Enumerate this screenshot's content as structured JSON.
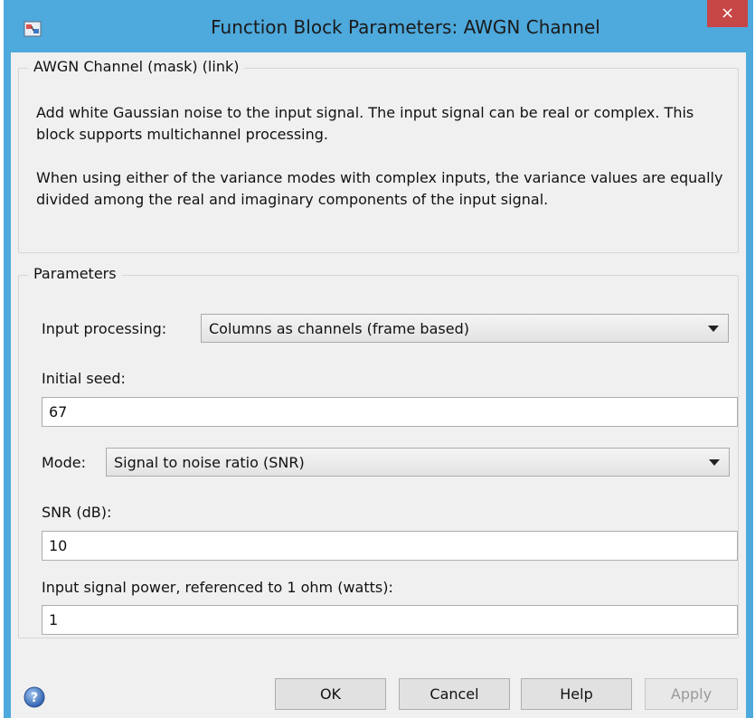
{
  "window": {
    "title": "Function Block Parameters: AWGN Channel",
    "close_glyph": "×",
    "icon": "simulink-block-icon"
  },
  "description": {
    "group_label": "AWGN Channel (mask) (link)",
    "paragraph1": "Add white Gaussian noise to the input signal. The input signal can be real or complex. This block supports multichannel processing.",
    "paragraph2": "When using either of the variance modes with complex inputs, the variance values are equally divided among the real and imaginary components of the input signal."
  },
  "parameters": {
    "group_label": "Parameters",
    "input_processing": {
      "label": "Input processing:",
      "value": "Columns as channels (frame based)"
    },
    "initial_seed": {
      "label": "Initial seed:",
      "value": "67"
    },
    "mode": {
      "label": "Mode:",
      "value": "Signal to noise ratio  (SNR)"
    },
    "snr": {
      "label": "SNR (dB):",
      "value": "10"
    },
    "input_power": {
      "label": "Input signal power, referenced to 1 ohm (watts):",
      "value": "1"
    }
  },
  "buttons": {
    "ok": "OK",
    "cancel": "Cancel",
    "help": "Help",
    "apply": "Apply"
  },
  "colors": {
    "titlebar": "#4ea9dc",
    "close": "#c74646",
    "client": "#f0f0f0"
  }
}
